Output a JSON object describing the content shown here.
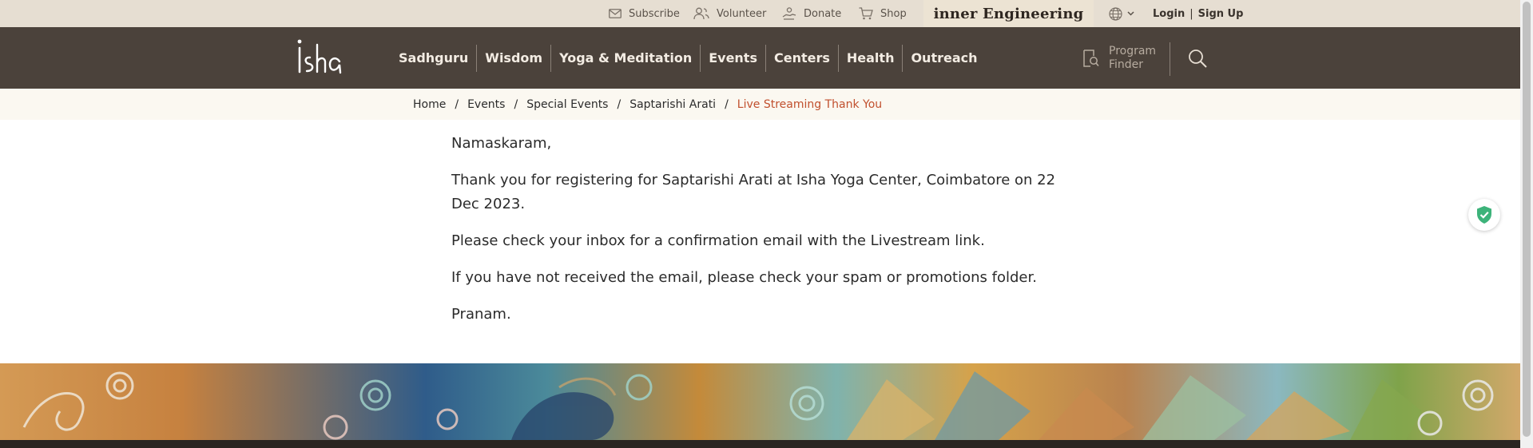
{
  "utility": {
    "subscribe": "Subscribe",
    "volunteer": "Volunteer",
    "donate": "Donate",
    "shop": "Shop",
    "inner_engineering": "inner Engineering",
    "login": "Login",
    "separator": "|",
    "signup": "Sign Up"
  },
  "nav": {
    "items": [
      {
        "label": "Sadhguru"
      },
      {
        "label": "Wisdom"
      },
      {
        "label": "Yoga & Meditation"
      },
      {
        "label": "Events"
      },
      {
        "label": "Centers"
      },
      {
        "label": "Health"
      },
      {
        "label": "Outreach"
      }
    ],
    "program_finder": "Program Finder"
  },
  "breadcrumb": {
    "items": [
      "Home",
      "Events",
      "Special Events",
      "Saptarishi Arati"
    ],
    "separator": "/",
    "current": "Live Streaming Thank You"
  },
  "content": {
    "paragraphs": [
      "Namaskaram,",
      "Thank you for registering for Saptarishi Arati at Isha Yoga Center, Coimbatore on 22 Dec 2023.",
      "Please check your inbox for a confirmation email with the Livestream link.",
      "If you have not received the email, please check your spam or promotions folder.",
      "Pranam."
    ]
  },
  "icons": {
    "logo": "isha-logo",
    "subscribe": "mail-icon",
    "volunteer": "users-icon",
    "donate": "donate-hand-icon",
    "shop": "cart-icon",
    "language": "globe-icon",
    "program_finder": "program-finder-icon",
    "search": "search-icon",
    "shield": "shield-check-icon"
  },
  "colors": {
    "utility_bg": "#e6ded2",
    "nav_bg": "#4b423b",
    "breadcrumb_current": "#c1502e",
    "shield_green": "#3db37a"
  }
}
